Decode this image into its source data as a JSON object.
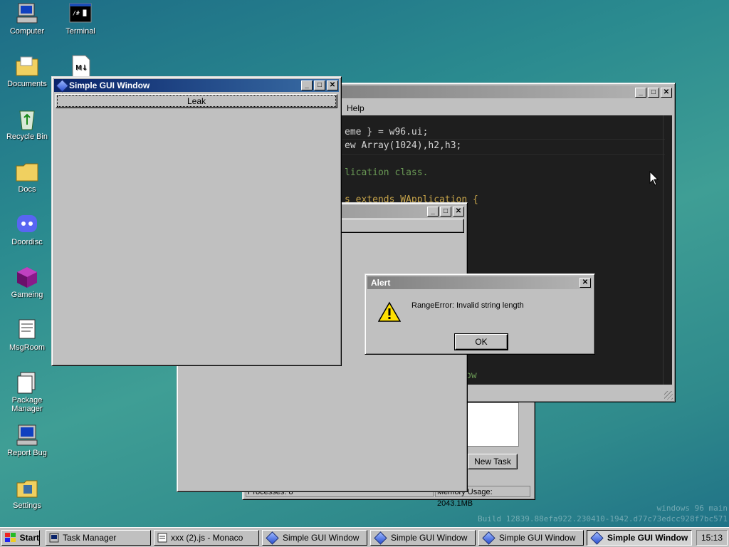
{
  "desktop": {
    "icons": [
      {
        "label": "Computer",
        "icon": "computer-icon"
      },
      {
        "label": "Terminal",
        "icon": "terminal-icon"
      },
      {
        "label": "Documents",
        "icon": "documents-folder-icon"
      },
      {
        "label": "Recycle Bin",
        "icon": "recycle-bin-icon"
      },
      {
        "label": "Docs",
        "icon": "folder-icon"
      },
      {
        "label": "Doordisc",
        "icon": "doordisc-icon"
      },
      {
        "label": "Gameing",
        "icon": "gameing-cube-icon"
      },
      {
        "label": "MsgRoom",
        "icon": "msgroom-icon"
      },
      {
        "label": "Package Manager",
        "icon": "package-manager-icon"
      },
      {
        "label": "Report Bug",
        "icon": "report-bug-icon"
      },
      {
        "label": "Settings",
        "icon": "settings-icon"
      }
    ],
    "terminal_icon_text": "/# █",
    "markdown_file_text": "M↓",
    "watermark_line1": "windows 96 main",
    "watermark_line2": "Build 12839.88efa922.230410-1942.d77c73edcc928f7bc571"
  },
  "monaco": {
    "menu_help": "Help",
    "code_lines": [
      {
        "text": "eme } = w96.ui;",
        "color": "#d4d4d4"
      },
      {
        "text": "ew Array(1024),h2,h3;",
        "color": "#d4d4d4"
      },
      {
        "text": "",
        "color": "#d4d4d4"
      },
      {
        "text": "lication class.",
        "color": "#6a9955"
      },
      {
        "text": "",
        "color": "#d4d4d4"
      },
      {
        "text": "s extends WApplication {",
        "color": "#c5a34a"
      }
    ],
    "code_bottom": "ow"
  },
  "task_manager": {
    "new_task_label": "New Task",
    "processes_label": "Processes: 8",
    "memory_label": "Memory Usage: 2043.1MB"
  },
  "simple_window": {
    "title": "Simple GUI Window",
    "leak_button": "Leak"
  },
  "alert": {
    "title": "Alert",
    "message": "RangeError: Invalid string length",
    "ok_label": "OK"
  },
  "taskbar": {
    "start_label": "Start",
    "tasks": [
      {
        "label": "Task Manager",
        "icon": "task-manager-icon"
      },
      {
        "label": "xxx (2).js - Monaco",
        "icon": "monaco-icon"
      },
      {
        "label": "Simple GUI Window",
        "icon": "diamond-icon"
      },
      {
        "label": "Simple GUI Window",
        "icon": "diamond-icon"
      },
      {
        "label": "Simple GUI Window",
        "icon": "diamond-icon"
      },
      {
        "label": "Simple GUI Window",
        "icon": "diamond-icon"
      }
    ],
    "clock": "15:13"
  },
  "colors": {
    "desktop_teal": "#2a8a8f",
    "titlebar_active": "#0a246a",
    "editor_bg": "#1e1e1e"
  }
}
